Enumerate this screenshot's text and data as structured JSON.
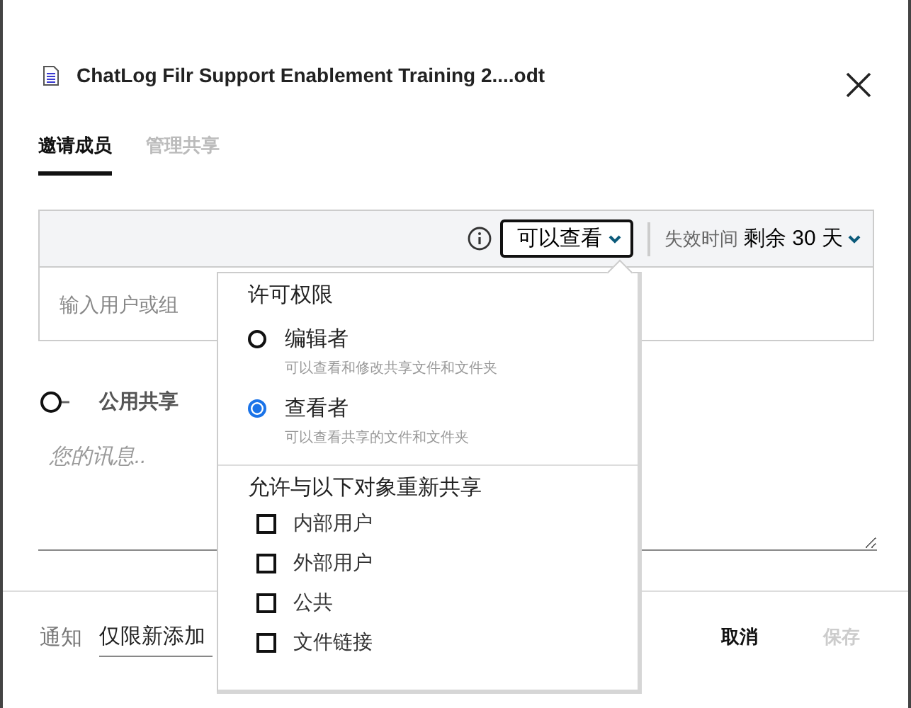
{
  "file": {
    "title": "ChatLog Filr Support Enablement Training 2....odt"
  },
  "tabs": [
    {
      "label": "邀请成员",
      "selected": true
    },
    {
      "label": "管理共享",
      "selected": false
    }
  ],
  "share_bar": {
    "access_button": "可以查看",
    "expiry_label": "失效时间",
    "expiry_value": "剩余 30 天"
  },
  "recipient_field": {
    "placeholder": "输入用户或组"
  },
  "public_share": {
    "label": "公用共享",
    "on": false
  },
  "message": {
    "placeholder": "您的讯息.."
  },
  "notify": {
    "label": "通知",
    "value": "仅限新添加"
  },
  "buttons": [
    {
      "label": "取消",
      "disabled": false
    },
    {
      "label": "保存",
      "disabled": true
    }
  ],
  "access_menu": {
    "title": "许可权限",
    "roles": [
      {
        "name": "编辑者",
        "description": "可以查看和修改共享文件和文件夹",
        "selected": false
      },
      {
        "name": "查看者",
        "description": "可以查看共享的文件和文件夹",
        "selected": true
      }
    ],
    "reshare_title": "允许与以下对象重新共享",
    "reshare_options": [
      {
        "label": "内部用户",
        "checked": false
      },
      {
        "label": "外部用户",
        "checked": false
      },
      {
        "label": "公共",
        "checked": false
      },
      {
        "label": "文件链接",
        "checked": false
      }
    ]
  }
}
